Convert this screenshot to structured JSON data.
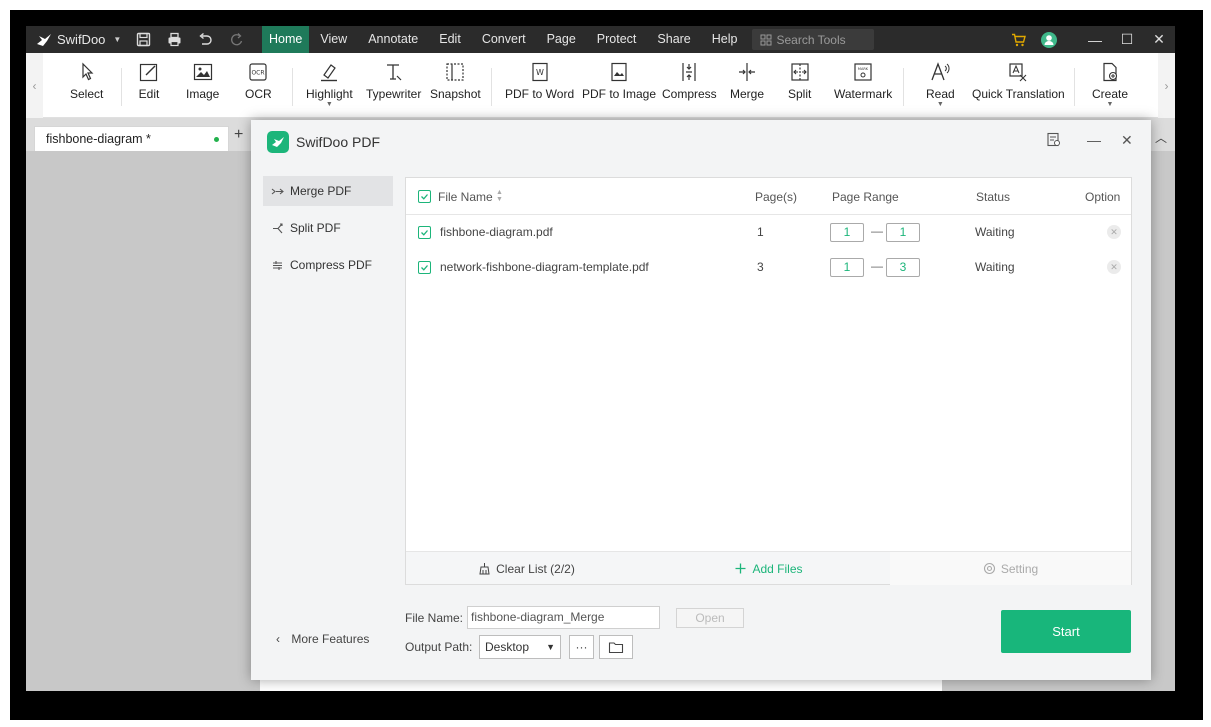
{
  "app": {
    "name": "SwifDoo",
    "menus": [
      "Home",
      "View",
      "Annotate",
      "Edit",
      "Convert",
      "Page",
      "Protect",
      "Share",
      "Help"
    ],
    "active_menu": "Home",
    "search_placeholder": "Search Tools"
  },
  "ribbon": {
    "tools": [
      {
        "label": "Select",
        "icon": "cursor-icon"
      },
      {
        "label": "Edit",
        "icon": "edit-icon"
      },
      {
        "label": "Image",
        "icon": "image-icon"
      },
      {
        "label": "OCR",
        "icon": "ocr-icon"
      },
      {
        "label": "Highlight",
        "icon": "highlight-icon"
      },
      {
        "label": "Typewriter",
        "icon": "typewriter-icon"
      },
      {
        "label": "Snapshot",
        "icon": "snapshot-icon"
      },
      {
        "label": "PDF to Word",
        "icon": "pdf-to-word-icon"
      },
      {
        "label": "PDF to Image",
        "icon": "pdf-to-image-icon"
      },
      {
        "label": "Compress",
        "icon": "compress-icon"
      },
      {
        "label": "Merge",
        "icon": "merge-icon"
      },
      {
        "label": "Split",
        "icon": "split-icon"
      },
      {
        "label": "Watermark",
        "icon": "watermark-icon"
      },
      {
        "label": "Read",
        "icon": "read-icon"
      },
      {
        "label": "Quick Translation",
        "icon": "translate-icon"
      },
      {
        "label": "Create",
        "icon": "create-icon"
      }
    ]
  },
  "tab": {
    "title": "fishbone-diagram *"
  },
  "dialog": {
    "title": "SwifDoo PDF",
    "nav": [
      {
        "label": "Merge PDF",
        "active": true
      },
      {
        "label": "Split PDF",
        "active": false
      },
      {
        "label": "Compress PDF",
        "active": false
      }
    ],
    "more_features": "More Features",
    "columns": {
      "file_name": "File Name",
      "pages": "Page(s)",
      "page_range": "Page Range",
      "status": "Status",
      "option": "Option"
    },
    "files": [
      {
        "name": "fishbone-diagram.pdf",
        "pages": "1",
        "range_from": "1",
        "range_to": "1",
        "status": "Waiting"
      },
      {
        "name": "network-fishbone-diagram-template.pdf",
        "pages": "3",
        "range_from": "1",
        "range_to": "3",
        "status": "Waiting"
      }
    ],
    "footer": {
      "clear_list": "Clear List (2/2)",
      "add_files": "Add Files",
      "setting": "Setting"
    },
    "file_name_label": "File Name:",
    "file_name_value": "fishbone-diagram_Merge",
    "open_label": "Open",
    "output_path_label": "Output Path:",
    "output_path_value": "Desktop",
    "more_button": "···",
    "start_label": "Start"
  },
  "colors": {
    "accent": "#18b67b",
    "menubar": "#2b2b2b",
    "active_menu": "#1f7a5a"
  }
}
